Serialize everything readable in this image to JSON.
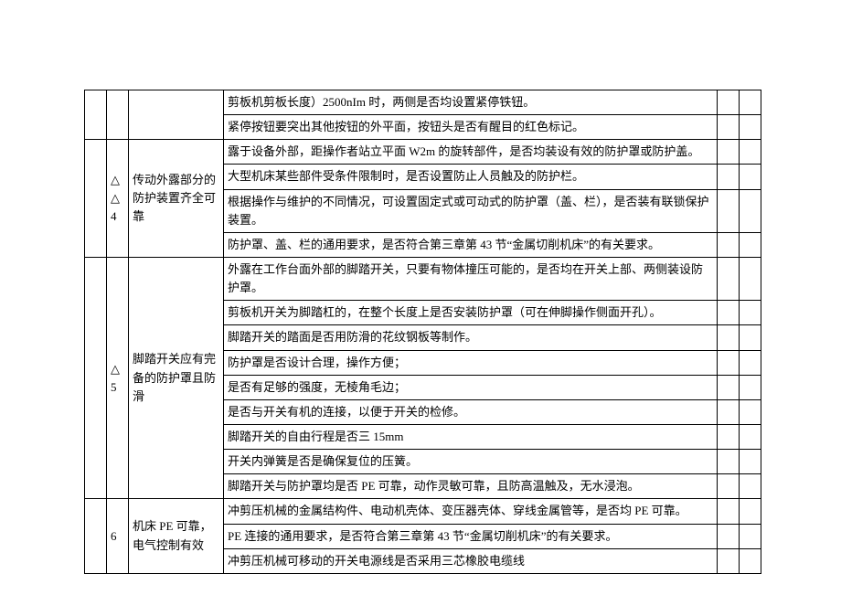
{
  "rows": [
    {
      "a": "",
      "b": "",
      "c": "",
      "d": "剪板机剪板长度）2500nIm 时，两侧是否均设置紧停铁钮。",
      "e": "",
      "f": ""
    },
    {
      "a": "",
      "b": "",
      "c": "",
      "d": "紧停按钮要突出其他按钮的外平面，按钮头是否有醒目的红色标记。",
      "e": "",
      "f": ""
    },
    {
      "group": "g4",
      "a": "",
      "b": "△\n4",
      "c": "传动外露部分的防护装置齐全可靠",
      "d": "露于设备外部，距操作者站立平面 W2m 的旋转部件，是否均装设有效的防护罩或防护盖。",
      "e": "",
      "f": ""
    },
    {
      "group": "g4",
      "d": "大型机床某些部件受条件限制时，是否设置防止人员触及的防护栏。"
    },
    {
      "group": "g4",
      "d": "根据操作与维护的不同情况，可设置固定式或可动式的防护罩（盖、栏），是否装有联锁保护装置。"
    },
    {
      "group": "g4",
      "d": "防护罩、盖、栏的通用要求，是否符合第三章第 43 节“金属切削机床”的有关要求。"
    },
    {
      "group": "g5",
      "a": "",
      "b": "△\n5",
      "c": "脚踏开关应有完备的防护罩且防滑",
      "d": "外露在工作台面外部的脚踏开关，只要有物体撞压可能的，是否均在开关上部、两侧装设防护罩。",
      "e": "",
      "f": ""
    },
    {
      "group": "g5",
      "d": "剪板机开关为脚踏杠的，在整个长度上是否安装防护罩（可在伸脚操作侧面开孔）。"
    },
    {
      "group": "g5",
      "d": "脚踏开关的踏面是否用防滑的花纹钢板等制作。"
    },
    {
      "group": "g5",
      "d": "防护罩是否设计合理，操作方便；"
    },
    {
      "group": "g5",
      "d": "是否有足够的强度，无棱角毛边；"
    },
    {
      "group": "g5",
      "d": "是否与开关有机的连接，以便于开关的检修。"
    },
    {
      "group": "g5",
      "d": "脚踏开关的自由行程是否三 15mm"
    },
    {
      "group": "g5",
      "d": "开关内弹簧是否是确保复位的压簧。"
    },
    {
      "group": "g5",
      "d": "脚踏开关与防护罩均是否 PE 可靠，动作灵敏可靠，且防高温触及，无水浸泡。"
    },
    {
      "group": "g6",
      "a": "",
      "b": "6",
      "c": "机床 PE 可靠，电气控制有效",
      "d": "冲剪压机械的金属结构件、电动机壳体、变压器壳体、穿线金属管等，是否均 PE 可靠。",
      "e": "",
      "f": ""
    },
    {
      "group": "g6",
      "d": "PE 连接的通用要求，是否符合第三章第 43 节“金属切削机床”的有关要求。"
    },
    {
      "group": "g6",
      "d": "冲剪压机械可移动的开关电源线是否采用三芯橡胶电缆线"
    }
  ]
}
